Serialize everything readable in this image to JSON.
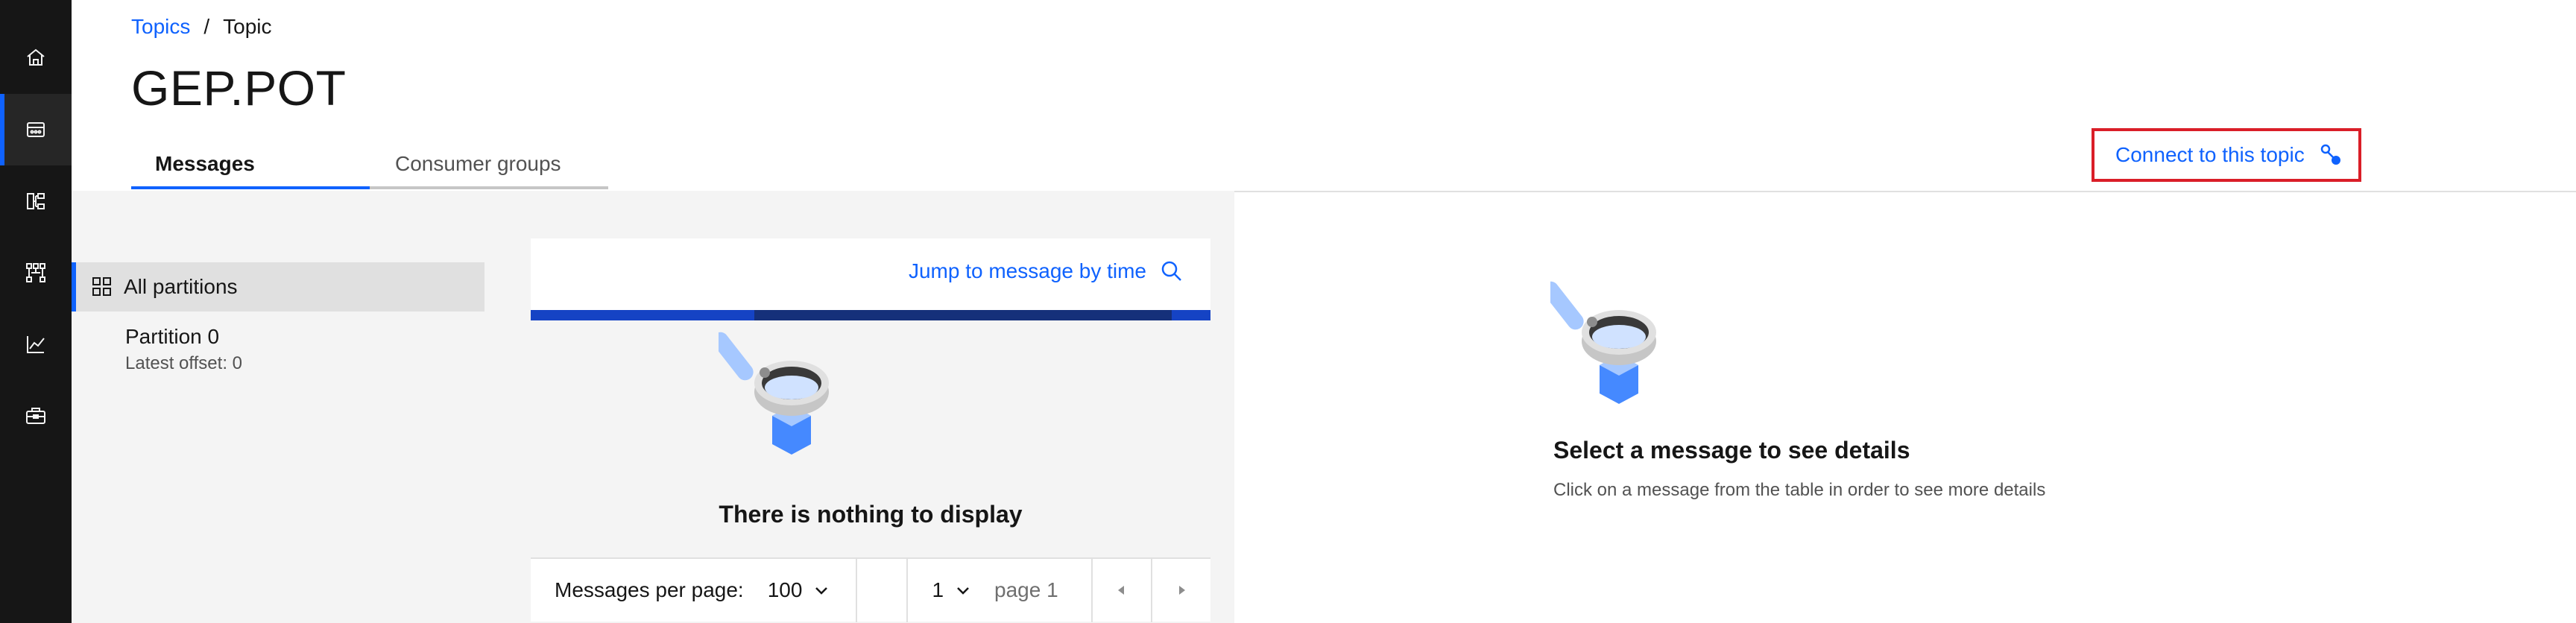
{
  "rail": {
    "items": [
      {
        "name": "home-icon",
        "active": false
      },
      {
        "name": "topics-icon",
        "active": true
      },
      {
        "name": "hierarchy-icon",
        "active": false
      },
      {
        "name": "network-icon",
        "active": false
      },
      {
        "name": "chart-icon",
        "active": false
      },
      {
        "name": "toolbox-icon",
        "active": false
      }
    ]
  },
  "breadcrumb": {
    "link": "Topics",
    "separator": "/",
    "current": "Topic"
  },
  "page": {
    "title": "GEP.POT"
  },
  "tabs": {
    "messages": "Messages",
    "consumer_groups": "Consumer groups"
  },
  "connect": {
    "label": "Connect to this topic"
  },
  "partitions": {
    "all_label": "All partitions",
    "items": [
      {
        "name": "Partition 0",
        "offset": "Latest offset: 0"
      }
    ]
  },
  "table": {
    "jump_label": "Jump to message by time",
    "empty_text": "There is nothing to display"
  },
  "pager": {
    "per_page_label": "Messages per page:",
    "per_page_value": "100",
    "page_value": "1",
    "page_label": "page 1"
  },
  "details": {
    "title": "Select a message to see details",
    "subtitle": "Click on a message from the table in order to see more details"
  },
  "colors": {
    "accent": "#0f62fe",
    "rail_bg": "#161616",
    "highlight_border": "#da1e28"
  }
}
